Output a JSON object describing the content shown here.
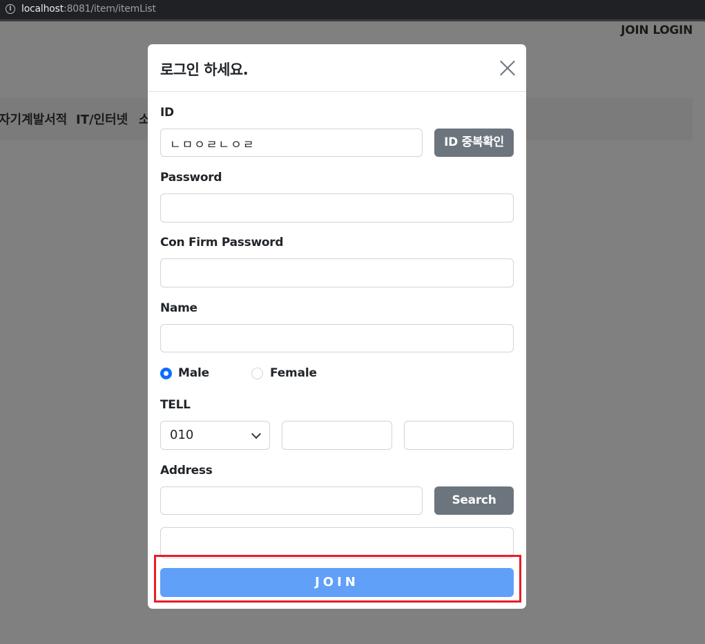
{
  "browser": {
    "url_host": "localhost",
    "url_rest_port": ":8081",
    "url_rest_path": "/item/itemList",
    "info_icon": "i"
  },
  "background": {
    "nav": [
      "JOIN",
      "LOGIN"
    ],
    "categories": [
      "자기계발서적",
      "IT/인터넷",
      "소"
    ]
  },
  "modal": {
    "title": "로그인 하세요.",
    "close_icon": "close-icon",
    "id": {
      "label": "ID",
      "value": "ㄴㅁㅇㄹㄴㅇㄹ",
      "check_button": "ID 중복확인"
    },
    "password": {
      "label": "Password",
      "value": ""
    },
    "confirm_password": {
      "label": "Con Firm Password",
      "value": ""
    },
    "name": {
      "label": "Name",
      "value": ""
    },
    "gender": {
      "options": [
        "Male",
        "Female"
      ],
      "selected": "Male"
    },
    "tell": {
      "label": "TELL",
      "prefix_selected": "010",
      "middle": "",
      "last": ""
    },
    "address": {
      "label": "Address",
      "value": "",
      "detail": "",
      "search_button": "Search"
    },
    "join_button": "JOIN"
  },
  "colors": {
    "overlay": "#808080",
    "primary_radio": "#0d6efd",
    "join_button": "#61a0f8",
    "gray_button": "#6c757d",
    "highlight": "#e81c23"
  }
}
